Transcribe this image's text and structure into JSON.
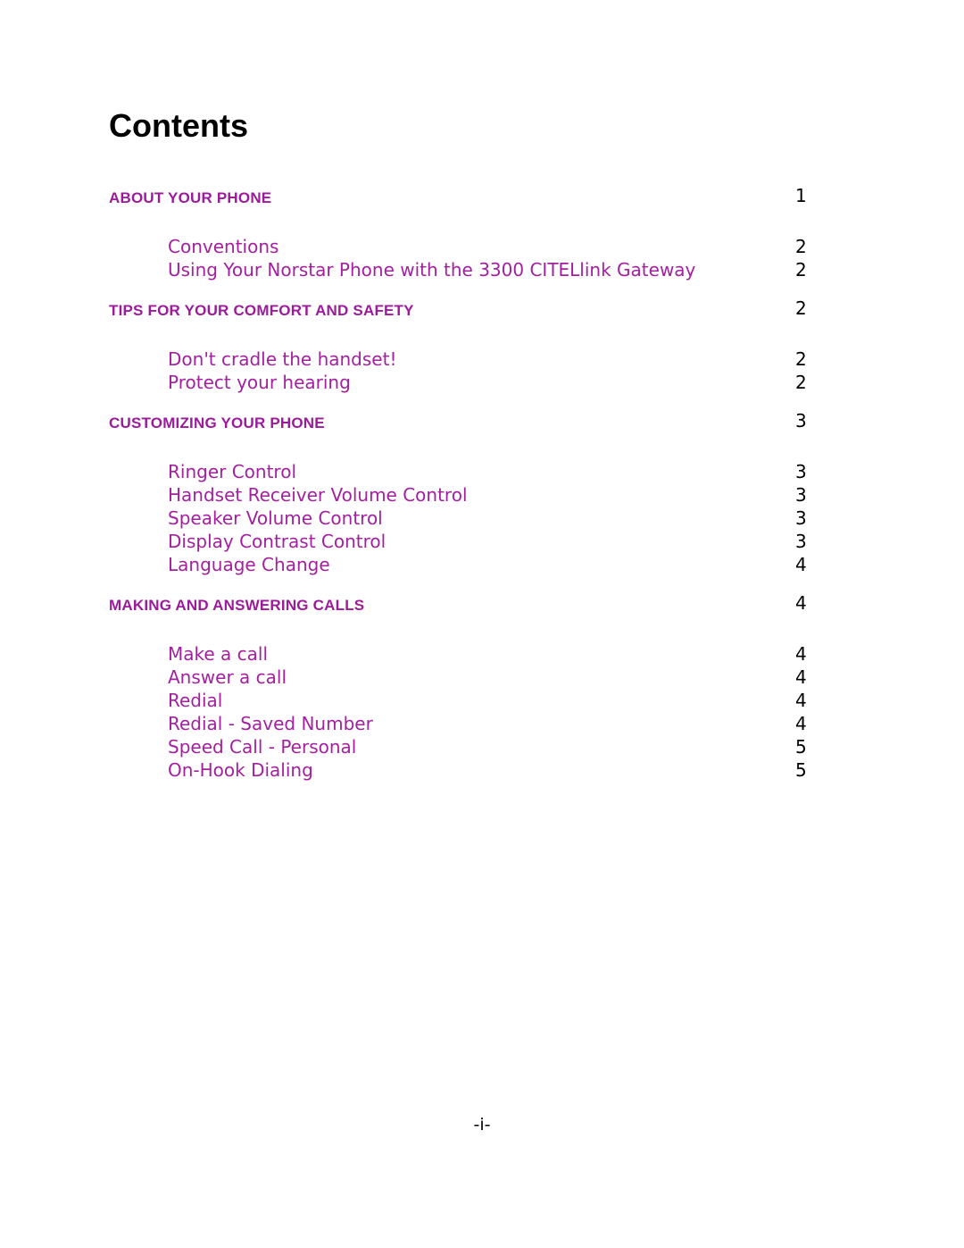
{
  "document": {
    "title": "Contents",
    "footer": "-i-"
  },
  "toc": {
    "entries": [
      {
        "level": 1,
        "label": "ABOUT YOUR PHONE",
        "page": "1"
      },
      {
        "level": 2,
        "label": "Conventions",
        "page": "2"
      },
      {
        "level": 2,
        "label": "Using Your Norstar Phone with the 3300 CITELlink Gateway",
        "page": "2"
      },
      {
        "level": 1,
        "label": "TIPS FOR YOUR COMFORT AND SAFETY",
        "page": "2"
      },
      {
        "level": 2,
        "label": "Don't cradle the handset!",
        "page": "2"
      },
      {
        "level": 2,
        "label": "Protect your hearing",
        "page": "2"
      },
      {
        "level": 1,
        "label": "CUSTOMIZING YOUR PHONE",
        "page": "3"
      },
      {
        "level": 2,
        "label": "Ringer Control",
        "page": "3"
      },
      {
        "level": 2,
        "label": "Handset Receiver Volume Control",
        "page": "3"
      },
      {
        "level": 2,
        "label": "Speaker Volume Control",
        "page": "3"
      },
      {
        "level": 2,
        "label": "Display Contrast Control",
        "page": "3"
      },
      {
        "level": 2,
        "label": "Language Change",
        "page": "4"
      },
      {
        "level": 1,
        "label": "MAKING AND ANSWERING CALLS",
        "page": "4"
      },
      {
        "level": 2,
        "label": "Make a call",
        "page": "4"
      },
      {
        "level": 2,
        "label": "Answer a call",
        "page": "4"
      },
      {
        "level": 2,
        "label": "Redial",
        "page": "4"
      },
      {
        "level": 2,
        "label": "Redial - Saved Number",
        "page": "4"
      },
      {
        "level": 2,
        "label": "Speed Call - Personal",
        "page": "5"
      },
      {
        "level": 2,
        "label": "On-Hook Dialing",
        "page": "5"
      }
    ]
  },
  "colors": {
    "heading_purple": "#9b1b9b",
    "entry_purple": "#a3219f",
    "page_number": "#000000"
  }
}
